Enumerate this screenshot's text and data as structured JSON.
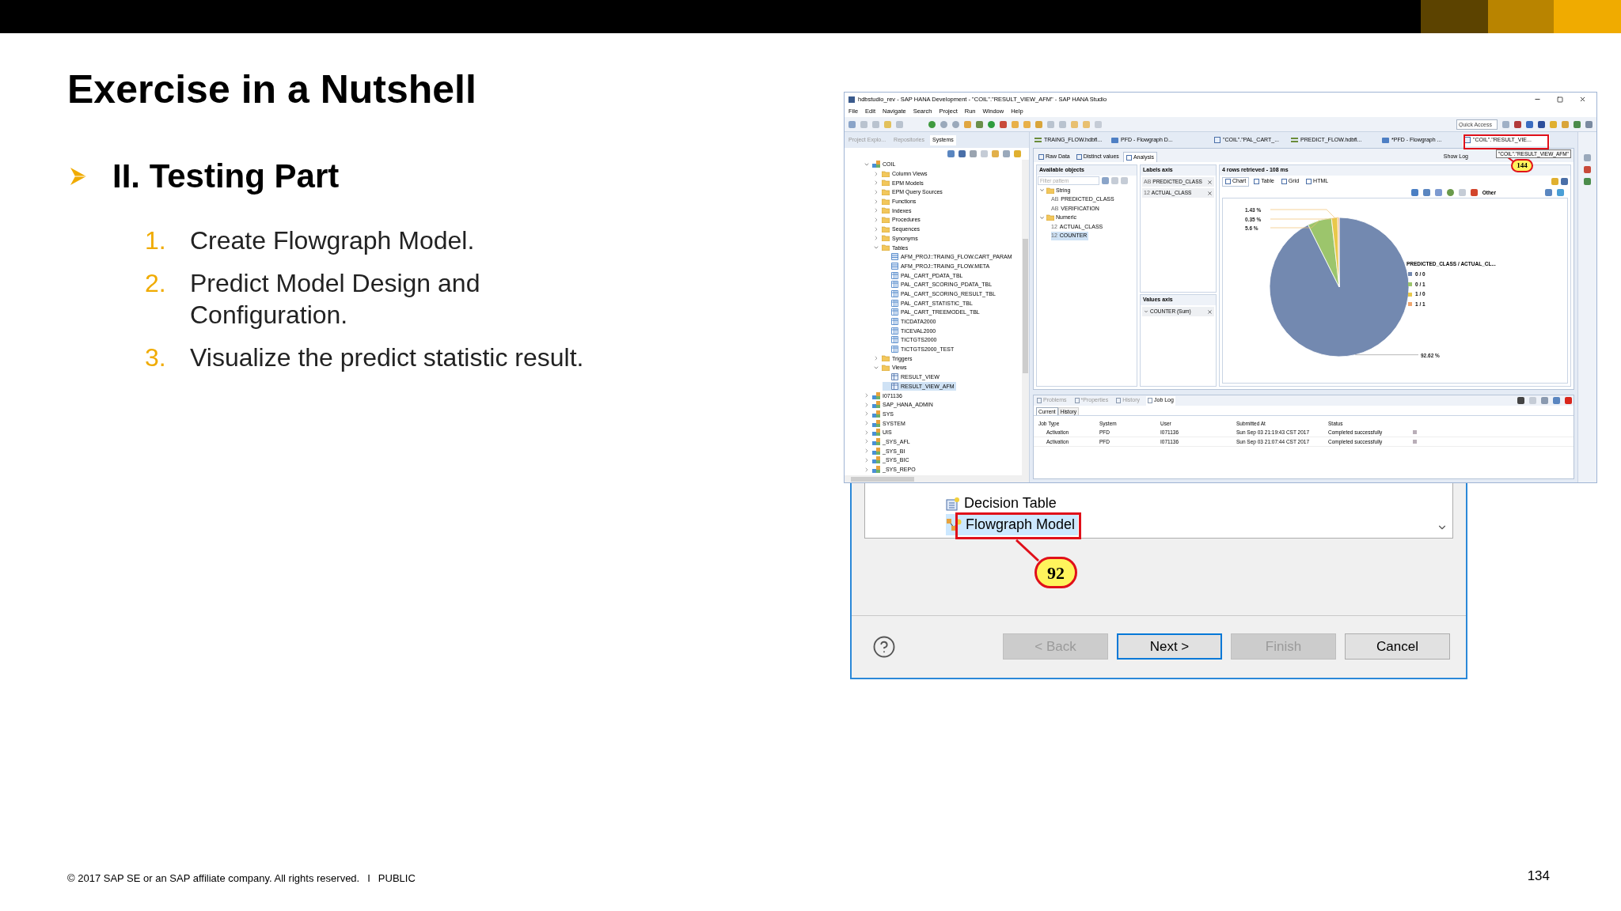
{
  "slide": {
    "title": "Exercise in a Nutshell",
    "section": "II. Testing Part",
    "steps": [
      {
        "number": "1.",
        "text": "Create Flowgraph Model."
      },
      {
        "number": "2.",
        "text": "Predict Model Design and Configuration."
      },
      {
        "number": "3.",
        "text": "Visualize the predict statistic result."
      }
    ],
    "footer": {
      "copyright": "© 2017 SAP SE or an SAP affiliate company. All rights reserved.",
      "separator": "I",
      "classification": "PUBLIC"
    },
    "page_number": "134"
  },
  "studio": {
    "title": "hdbstudio_rev - SAP HANA Development - \"COIL\".\"RESULT_VIEW_AFM\" - SAP HANA Studio",
    "menu": [
      "File",
      "Edit",
      "Navigate",
      "Search",
      "Project",
      "Run",
      "Window",
      "Help"
    ],
    "quick_access": {
      "placeholder": "Quick Access"
    },
    "left_tabs": [
      {
        "label": "Project Explo...",
        "selected": false
      },
      {
        "label": "Repositories",
        "selected": false
      },
      {
        "label": "Systems",
        "selected": true
      }
    ],
    "tree": [
      {
        "label": "COIL",
        "kind": "schema",
        "expanded": true,
        "selected": false,
        "children": [
          {
            "label": "Column Views",
            "kind": "folder",
            "expanded": false,
            "selected": false
          },
          {
            "label": "EPM Models",
            "kind": "folder",
            "expanded": false,
            "selected": false
          },
          {
            "label": "EPM Query Sources",
            "kind": "folder",
            "expanded": false,
            "selected": false
          },
          {
            "label": "Functions",
            "kind": "folder",
            "expanded": false,
            "selected": false
          },
          {
            "label": "Indexes",
            "kind": "folder",
            "expanded": false,
            "selected": false
          },
          {
            "label": "Procedures",
            "kind": "folder",
            "expanded": false,
            "selected": false
          },
          {
            "label": "Sequences",
            "kind": "folder",
            "expanded": false,
            "selected": false
          },
          {
            "label": "Synonyms",
            "kind": "folder",
            "expanded": false,
            "selected": false
          },
          {
            "label": "Tables",
            "kind": "folder",
            "expanded": true,
            "selected": false,
            "children": [
              {
                "label": "AFM_PROJ::TRAING_FLOW.CART_PARAM",
                "kind": "design_table",
                "selected": false
              },
              {
                "label": "AFM_PROJ::TRAING_FLOW.META",
                "kind": "design_table",
                "selected": false
              },
              {
                "label": "PAL_CART_PDATA_TBL",
                "kind": "table",
                "selected": false
              },
              {
                "label": "PAL_CART_SCORING_PDATA_TBL",
                "kind": "table",
                "selected": false
              },
              {
                "label": "PAL_CART_SCORING_RESULT_TBL",
                "kind": "table",
                "selected": false
              },
              {
                "label": "PAL_CART_STATISTIC_TBL",
                "kind": "table",
                "selected": false
              },
              {
                "label": "PAL_CART_TREEMODEL_TBL",
                "kind": "table",
                "selected": false
              },
              {
                "label": "TICDATA2000",
                "kind": "table",
                "selected": false
              },
              {
                "label": "TICEVAL2000",
                "kind": "table",
                "selected": false
              },
              {
                "label": "TICTGTS2000",
                "kind": "table",
                "selected": false
              },
              {
                "label": "TICTGTS2000_TEST",
                "kind": "table",
                "selected": false
              }
            ]
          },
          {
            "label": "Triggers",
            "kind": "folder",
            "expanded": false,
            "selected": false
          },
          {
            "label": "Views",
            "kind": "folder",
            "expanded": true,
            "selected": false,
            "children": [
              {
                "label": "RESULT_VIEW",
                "kind": "view",
                "selected": false
              },
              {
                "label": "RESULT_VIEW_AFM",
                "kind": "view",
                "selected": true
              }
            ]
          }
        ]
      },
      {
        "label": "I071136",
        "kind": "schema",
        "expanded": false,
        "selected": false
      },
      {
        "label": "SAP_HANA_ADMIN",
        "kind": "schema",
        "expanded": false,
        "selected": false
      },
      {
        "label": "SYS",
        "kind": "schema",
        "expanded": false,
        "selected": false
      },
      {
        "label": "SYSTEM",
        "kind": "schema",
        "expanded": false,
        "selected": false
      },
      {
        "label": "UIS",
        "kind": "schema",
        "expanded": false,
        "selected": false
      },
      {
        "label": "_SYS_AFL",
        "kind": "schema",
        "expanded": false,
        "selected": false
      },
      {
        "label": "_SYS_BI",
        "kind": "schema",
        "expanded": false,
        "selected": false
      },
      {
        "label": "_SYS_BIC",
        "kind": "schema",
        "expanded": false,
        "selected": false
      },
      {
        "label": "_SYS_REPO",
        "kind": "schema",
        "expanded": false,
        "selected": false
      }
    ],
    "editor_tabs": [
      {
        "label": "TRAING_FLOW.hdbfl...",
        "kind": "flow",
        "selected": false
      },
      {
        "label": "PFD - Flowgraph D...",
        "kind": "sql",
        "selected": false
      },
      {
        "label": "\"COIL\".\"PAL_CART_...",
        "kind": "view",
        "selected": false
      },
      {
        "label": "PREDICT_FLOW.hdbfl...",
        "kind": "flow",
        "selected": false
      },
      {
        "label": "*PFD - Flowgraph ...",
        "kind": "sql",
        "selected": false
      },
      {
        "label": "\"COIL\".\"RESULT_VIE...",
        "kind": "view",
        "selected": true
      }
    ],
    "tooltip": "\"COIL\".\"RESULT_VIEW_AFM\"",
    "callout": "144",
    "view_tabs": [
      {
        "label": "Raw Data",
        "selected": false
      },
      {
        "label": "Distinct values",
        "selected": false
      },
      {
        "label": "Analysis",
        "selected": true
      }
    ],
    "show_log": "Show Log",
    "available_objects": {
      "title": "Available objects",
      "filter": {
        "placeholder": "Filter pattern"
      },
      "groups": [
        {
          "label": "String",
          "expanded": true,
          "children": [
            {
              "label": "PREDICTED_CLASS",
              "type": "AB",
              "selected": false
            },
            {
              "label": "VERIFICATION",
              "type": "AB",
              "selected": false
            }
          ]
        },
        {
          "label": "Numeric",
          "expanded": true,
          "children": [
            {
              "label": "ACTUAL_CLASS",
              "type": "12",
              "selected": false
            },
            {
              "label": "COUNTER",
              "type": "12",
              "selected": true
            }
          ]
        }
      ]
    },
    "labels_axis": {
      "title": "Labels axis",
      "items": [
        {
          "label": "PREDICTED_CLASS",
          "type": "AB"
        },
        {
          "label": "ACTUAL_CLASS",
          "type": "12"
        }
      ]
    },
    "values_axis": {
      "title": "Values axis",
      "items": [
        {
          "label": "COUNTER (Sum)"
        }
      ]
    },
    "chart_panel": {
      "status": "4 rows retrieved - 108 ms",
      "tabs": [
        {
          "label": "Chart",
          "selected": true
        },
        {
          "label": "Table",
          "selected": false
        },
        {
          "label": "Grid",
          "selected": false
        },
        {
          "label": "HTML",
          "selected": false
        }
      ],
      "other": "Other",
      "legend_title": "PREDICTED_CLASS / ACTUAL_CL...",
      "chart_data": {
        "type": "pie",
        "categories": [
          "0 / 0",
          "0 / 1",
          "1 / 0",
          "1 / 1"
        ],
        "series": [
          {
            "values": [
              92.62,
              5.6,
              1.43,
              0.35
            ]
          }
        ],
        "value_labels": [
          "92.62 %",
          "5.6 %",
          "1.43 %",
          "0.35 %"
        ]
      }
    },
    "bottom_tabs": [
      {
        "label": "Problems",
        "selected": false
      },
      {
        "label": "*Properties",
        "selected": false
      },
      {
        "label": "History",
        "selected": false
      },
      {
        "label": "Job Log",
        "selected": true
      }
    ],
    "job_subtabs": [
      {
        "label": "Current",
        "selected": true
      },
      {
        "label": "History",
        "selected": false
      }
    ],
    "job_columns": [
      "Job Type",
      "System",
      "User",
      "Submitted At",
      "Status"
    ],
    "job_rows": [
      [
        "Activation",
        "PFD",
        "I071136",
        "Sun Sep 03 21:19:43 CST 2017",
        "Completed successfully"
      ],
      [
        "Activation",
        "PFD",
        "I071136",
        "Sun Sep 03 21:07:44 CST 2017",
        "Completed successfully"
      ]
    ]
  },
  "dialog": {
    "items": [
      {
        "label": "Decision Table",
        "kind": "decision",
        "selected": false
      },
      {
        "label": "Flowgraph Model",
        "kind": "flowgraph",
        "selected": true
      }
    ],
    "callout": "92",
    "buttons": [
      {
        "label": "< Back",
        "disabled": true,
        "default": false
      },
      {
        "label": "Next >",
        "disabled": false,
        "default": true
      },
      {
        "label": "Finish",
        "disabled": true,
        "default": false
      },
      {
        "label": "Cancel",
        "disabled": false,
        "default": false
      }
    ]
  }
}
